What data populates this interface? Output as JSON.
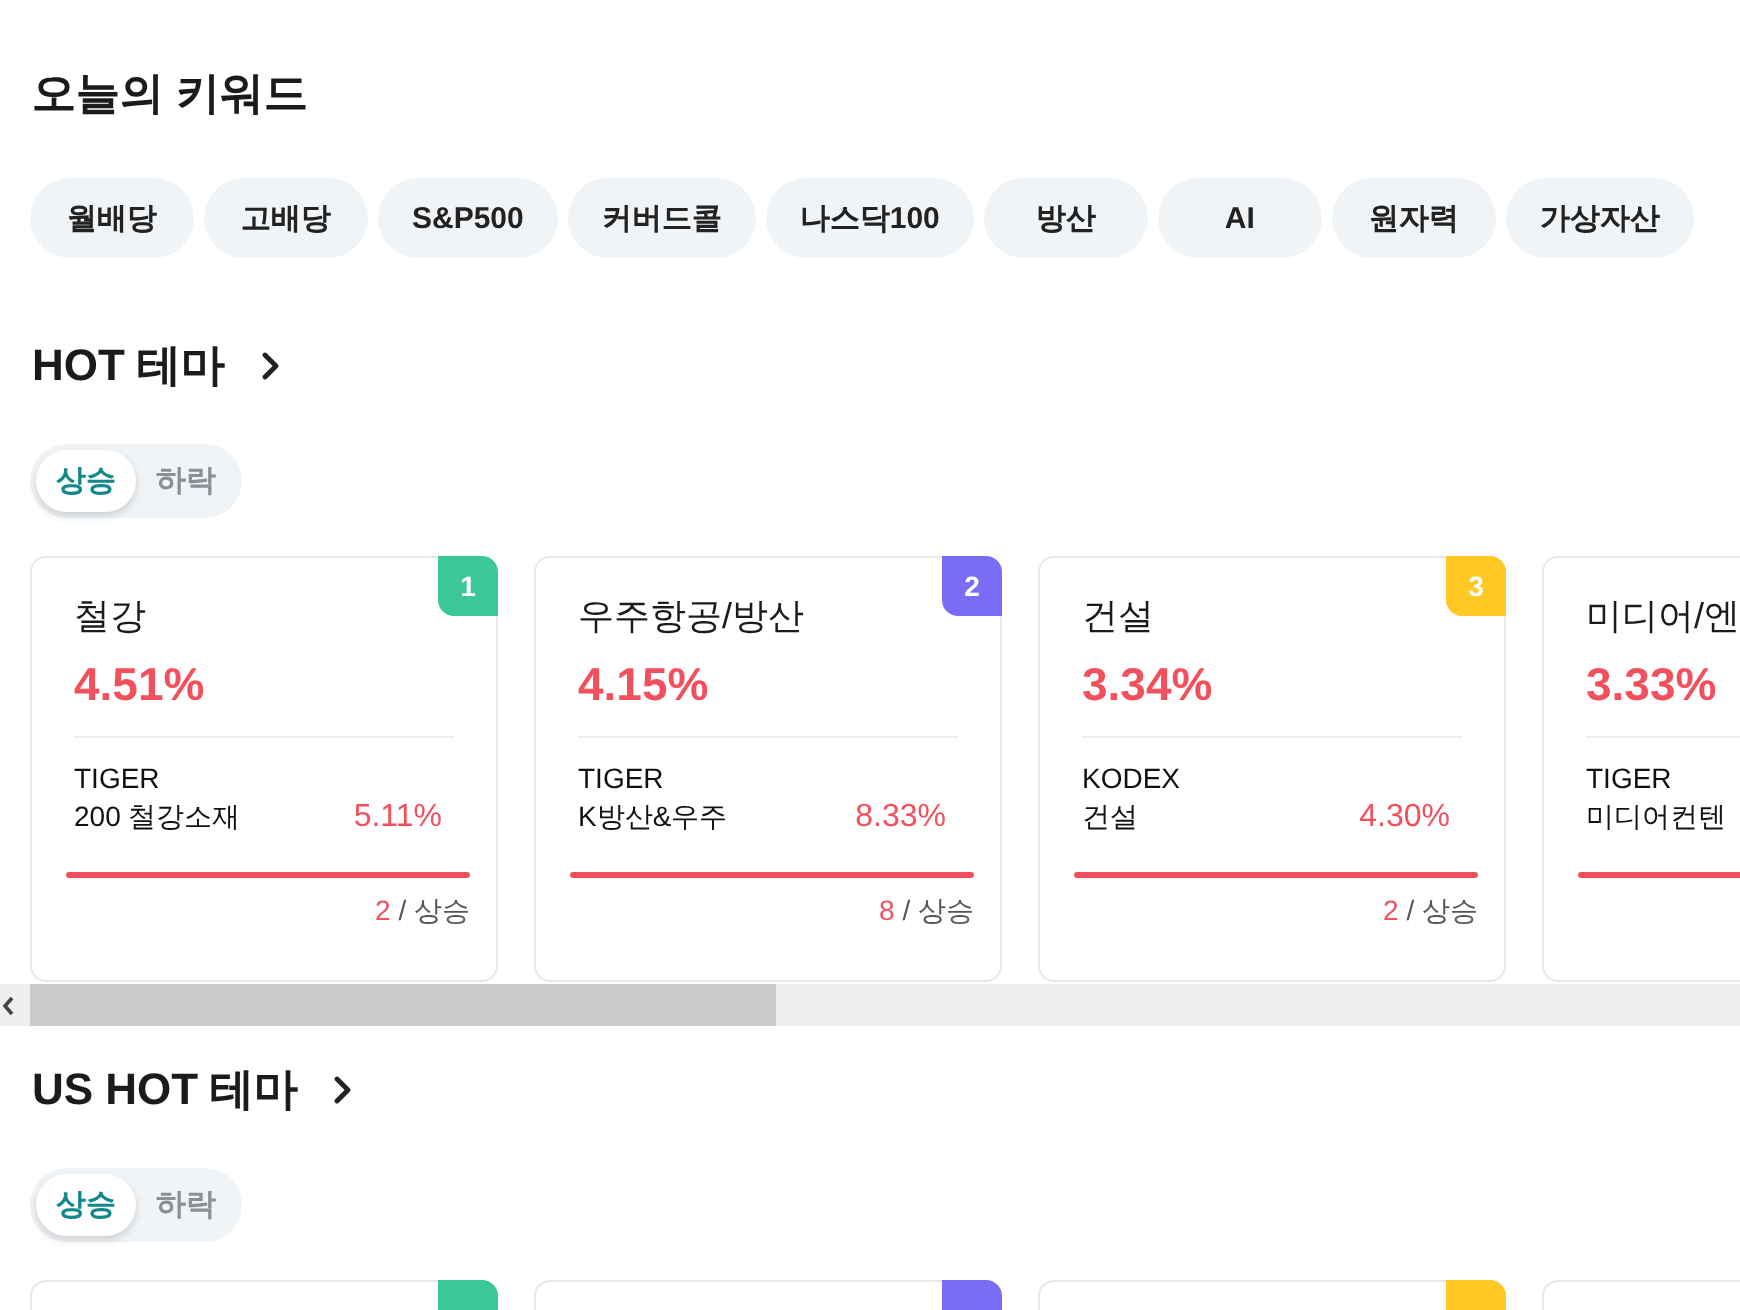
{
  "keywords": {
    "title": "오늘의 키워드",
    "chips": [
      "월배당",
      "고배당",
      "S&P500",
      "커버드콜",
      "나스닥100",
      "방산",
      "AI",
      "원자력",
      "가상자산"
    ]
  },
  "sections": [
    {
      "title": "HOT 테마",
      "tabs": [
        {
          "label": "상승",
          "selected": true
        },
        {
          "label": "하락",
          "selected": false
        }
      ],
      "scrollbar": true,
      "cards": [
        {
          "kind": "ranked",
          "rank": "1",
          "color": "#3cc796",
          "theme": "철강",
          "change": "4.51%",
          "etf_brand": "TIGER",
          "etf_name": "200 철강소재",
          "etf_change": "5.11%",
          "count": "2",
          "direction": "/ 상승"
        },
        {
          "kind": "ranked",
          "rank": "2",
          "color": "#7b6cf6",
          "theme": "우주항공/방산",
          "change": "4.15%",
          "etf_brand": "TIGER",
          "etf_name": "K방산&우주",
          "etf_change": "8.33%",
          "count": "8",
          "direction": "/ 상승"
        },
        {
          "kind": "ranked",
          "rank": "3",
          "color": "#ffc824",
          "theme": "건설",
          "change": "3.34%",
          "etf_brand": "KODEX",
          "etf_name": "건설",
          "etf_change": "4.30%",
          "count": "2",
          "direction": "/ 상승"
        },
        {
          "kind": "plain",
          "theme": "미디어/엔",
          "change": "3.33%",
          "etf_brand": "TIGER",
          "etf_name": "미디어컨텐"
        }
      ]
    },
    {
      "title": "US HOT 테마",
      "tabs": [
        {
          "label": "상승",
          "selected": true
        },
        {
          "label": "하락",
          "selected": false
        }
      ],
      "cards": [
        {
          "kind": "ranked",
          "color": "#3cc796"
        },
        {
          "kind": "ranked",
          "color": "#7b6cf6"
        },
        {
          "kind": "ranked",
          "color": "#ffc824"
        },
        {
          "kind": "plain"
        }
      ]
    }
  ]
}
